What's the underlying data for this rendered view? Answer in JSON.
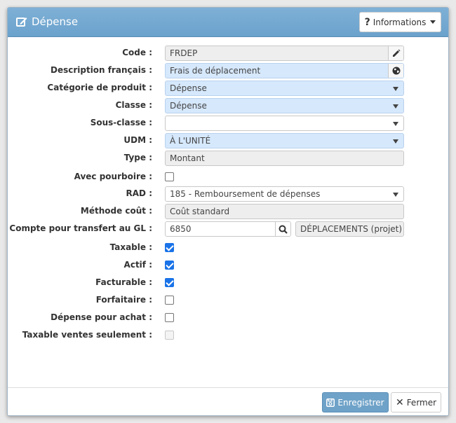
{
  "dialog": {
    "title": "Dépense",
    "info_button": "Informations"
  },
  "form": {
    "code": {
      "label": "Code :",
      "value": "FRDEP"
    },
    "description": {
      "label": "Description français :",
      "value": "Frais de déplacement"
    },
    "categorie": {
      "label": "Catégorie de produit :",
      "value": "Dépense"
    },
    "classe": {
      "label": "Classe :",
      "value": "Dépense"
    },
    "sous_classe": {
      "label": "Sous-classe :",
      "value": ""
    },
    "udm": {
      "label": "UDM :",
      "value": "À L'UNITÉ"
    },
    "type": {
      "label": "Type :",
      "value": "Montant"
    },
    "avec_pourboire": {
      "label": "Avec pourboire :",
      "checked": false
    },
    "rad": {
      "label": "RAD :",
      "value": "185 - Remboursement de dépenses"
    },
    "methode_cout": {
      "label": "Méthode coût :",
      "value": "Coût standard"
    },
    "compte_gl": {
      "label": "Compte pour transfert au GL :",
      "value": "6850",
      "description": "DÉPLACEMENTS (projet)"
    },
    "taxable": {
      "label": "Taxable :",
      "checked": true
    },
    "actif": {
      "label": "Actif :",
      "checked": true
    },
    "facturable": {
      "label": "Facturable :",
      "checked": true
    },
    "forfaitaire": {
      "label": "Forfaitaire :",
      "checked": false
    },
    "depense_achat": {
      "label": "Dépense pour achat :",
      "checked": false
    },
    "taxable_ventes": {
      "label": "Taxable ventes seulement :",
      "checked": false,
      "disabled": true
    }
  },
  "footer": {
    "save_label": "Enregistrer",
    "close_label": "Fermer"
  },
  "colors": {
    "header": "#6aa2cc",
    "highlight_field": "#d6e8fc",
    "checkbox_checked": "#1a73e8"
  }
}
